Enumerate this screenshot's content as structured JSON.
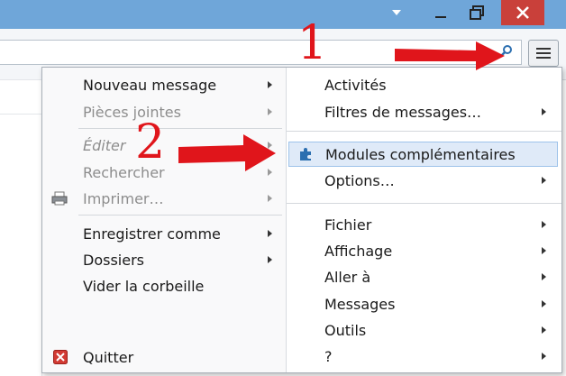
{
  "window": {
    "colors": {
      "titlebar": "#6fa6d9",
      "close": "#c9403a",
      "accent_arrow": "#e0151b"
    }
  },
  "menu": {
    "left": {
      "new_message": "Nouveau message",
      "attachments": "Pièces jointes",
      "edit": "Éditer",
      "find": "Rechercher",
      "print": "Imprimer…",
      "save_as": "Enregistrer comme",
      "folders": "Dossiers",
      "empty_trash": "Vider la corbeille",
      "quit": "Quitter"
    },
    "right": {
      "activities": "Activités",
      "message_filters": "Filtres de messages…",
      "addons": "Modules complémentaires",
      "options": "Options…",
      "file": "Fichier",
      "view": "Affichage",
      "go": "Aller à",
      "messages": "Messages",
      "tools": "Outils",
      "help": "?"
    }
  },
  "annotations": {
    "step1": "1",
    "step2": "2"
  }
}
